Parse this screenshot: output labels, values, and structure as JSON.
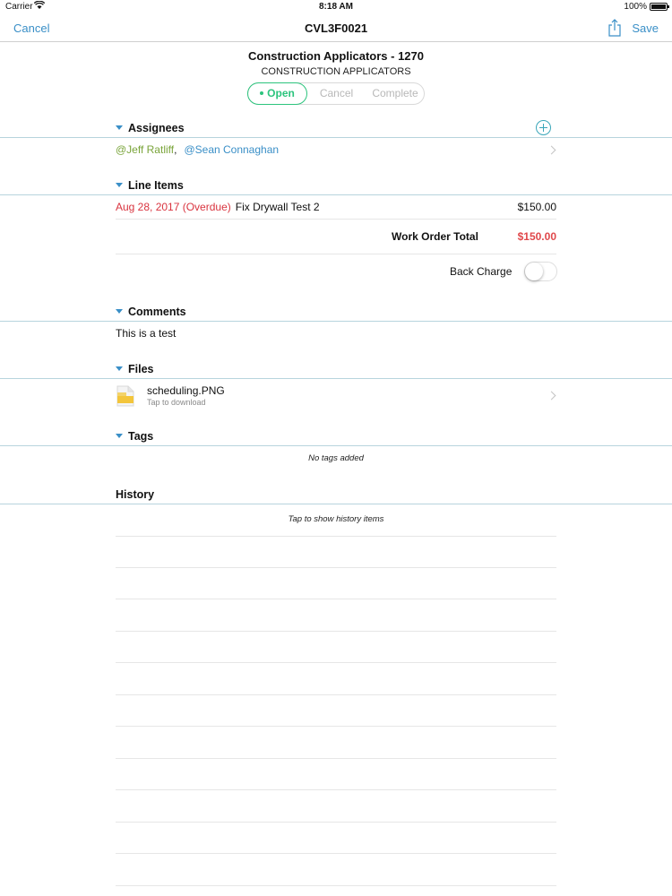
{
  "status_bar": {
    "carrier": "Carrier",
    "time": "8:18 AM",
    "battery": "100%"
  },
  "nav": {
    "cancel": "Cancel",
    "title": "CVL3F0021",
    "save": "Save",
    "share_icon": "share-icon"
  },
  "order": {
    "title": "Construction Applicators - 1270",
    "company": "CONSTRUCTION APPLICATORS",
    "status_options": [
      "Open",
      "Cancel",
      "Complete"
    ],
    "selected_status": "Open",
    "status_color": "#2cc47d"
  },
  "assignees": {
    "header": "Assignees",
    "people": [
      "@Jeff Ratliff",
      "@Sean Connaghan"
    ],
    "separator": ","
  },
  "line_items": {
    "header": "Line Items",
    "items": [
      {
        "due": "Aug 28, 2017 (Overdue)",
        "description": "Fix Drywall Test 2",
        "amount": "$150.00"
      }
    ],
    "total_label": "Work Order Total",
    "total_value": "$150.00",
    "back_charge_label": "Back Charge",
    "back_charge_on": false
  },
  "comments": {
    "header": "Comments",
    "text": "This is a test"
  },
  "files": {
    "header": "Files",
    "items": [
      {
        "name": "scheduling.PNG",
        "subtitle": "Tap to download"
      }
    ]
  },
  "tags": {
    "header": "Tags",
    "empty_text": "No tags added"
  },
  "history": {
    "header": "History",
    "hint": "Tap to show history items"
  },
  "colors": {
    "accent": "#3a8fc7",
    "overdue": "#d9343f",
    "total": "#e0484b",
    "assignee_1": "#7aa43a"
  }
}
